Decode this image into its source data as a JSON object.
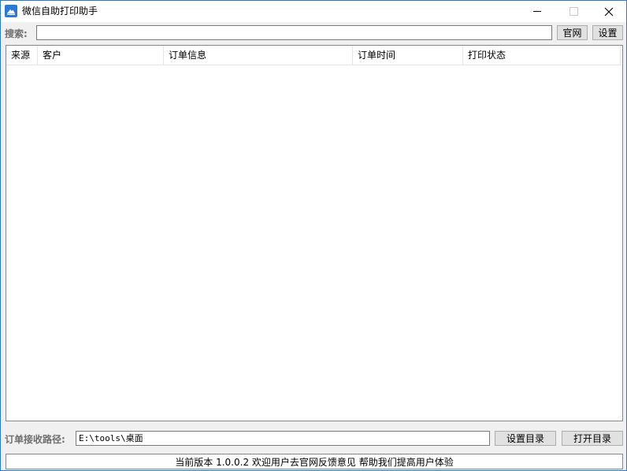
{
  "window": {
    "title": "微信自助打印助手"
  },
  "search": {
    "label": "搜索:",
    "value": "",
    "official_site_button": "官网",
    "settings_button": "设置"
  },
  "order_list": {
    "columns": [
      "来源",
      "客户",
      "订单信息",
      "订单时间",
      "打印状态"
    ],
    "rows": []
  },
  "path_bar": {
    "label": "订单接收路径:",
    "value": "E:\\tools\\桌面",
    "set_dir_button": "设置目录",
    "open_dir_button": "打开目录"
  },
  "status": {
    "text": "当前版本 1.0.0.2 欢迎用户去官网反馈意见 帮助我们提高用户体验"
  },
  "colors": {
    "window_border": "#2b79d7",
    "app_icon": "#2b79d7",
    "dialog_bg": "#f0f0f0"
  },
  "icons": {
    "app": "printer-app-icon",
    "minimize": "minimize-icon",
    "maximize": "maximize-icon",
    "close": "close-icon"
  }
}
